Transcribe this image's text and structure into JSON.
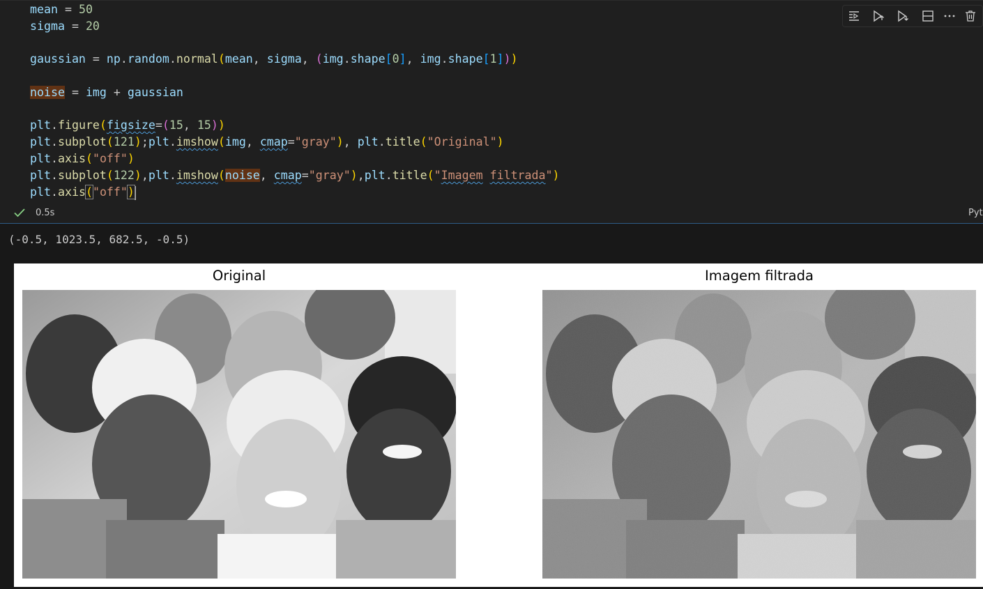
{
  "code": {
    "mean_var": "mean",
    "mean_val": "50",
    "sigma_var": "sigma",
    "sigma_val": "20",
    "l3": {
      "gaussian": "gaussian",
      "np": "np",
      "random": "random",
      "normal": "normal",
      "mean": "mean",
      "sigma": "sigma",
      "img1": "img",
      "shape1": "shape",
      "idx0": "0",
      "img2": "img",
      "shape2": "shape",
      "idx1": "1"
    },
    "l4": {
      "noise": "noise",
      "img": "img",
      "gaussian": "gaussian"
    },
    "l5": {
      "plt": "plt",
      "figure": "figure",
      "figsize": "figsize",
      "n1": "15",
      "n2": "15"
    },
    "l6": {
      "plt1": "plt",
      "subplot": "subplot",
      "num": "121",
      "plt2": "plt",
      "imshow": "imshow",
      "img": "img",
      "cmap": "cmap",
      "gray": "\"gray\"",
      "plt3": "plt",
      "title": "title",
      "title_str": "\"Original\""
    },
    "l7": {
      "plt": "plt",
      "axis": "axis",
      "off": "\"off\""
    },
    "l8": {
      "plt1": "plt",
      "subplot": "subplot",
      "num": "122",
      "plt2": "plt",
      "imshow": "imshow",
      "noise": "noise",
      "cmap": "cmap",
      "gray": "\"gray\"",
      "plt3": "plt",
      "title": "title",
      "title_q1": "\"",
      "title_w1": "Imagem",
      "title_w2": "filtrada",
      "title_q2": "\""
    },
    "l9": {
      "plt": "plt",
      "axis": "axis",
      "off": "\"off\""
    }
  },
  "toolbar": {
    "icons": [
      "run-by-line-icon",
      "execute-above-icon",
      "execute-below-icon",
      "split-cell-icon",
      "more-icon",
      "delete-icon"
    ]
  },
  "status": {
    "time": "0.5s",
    "language": "Pyt"
  },
  "output": {
    "text": "(-0.5, 1023.5, 682.5, -0.5)"
  },
  "figure": {
    "left_title": "Original",
    "right_title": "Imagem filtrada"
  },
  "colors": {
    "editor_bg": "#1f1f1f",
    "variable": "#9cdcfe",
    "function": "#dcdcaa",
    "number": "#b5cea8",
    "string": "#ce9178",
    "success": "#89d185"
  }
}
